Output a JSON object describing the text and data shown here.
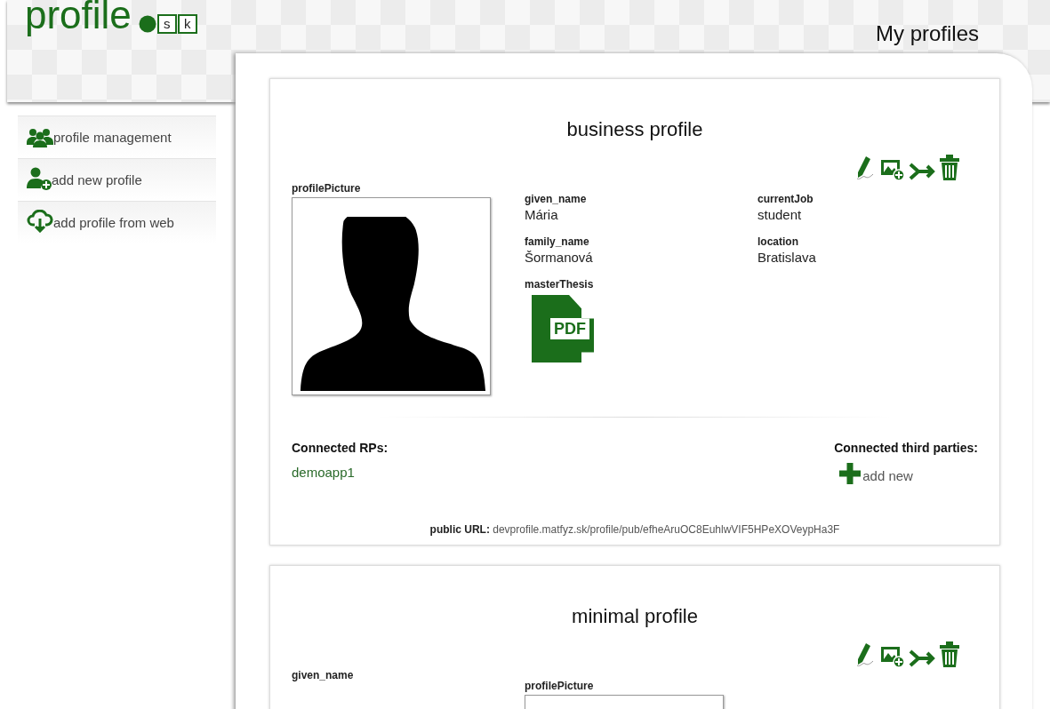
{
  "logo": {
    "word": "profile",
    "letters": [
      "s",
      "k"
    ]
  },
  "page_title": "My profiles",
  "sidebar": {
    "items": [
      {
        "kind": "group",
        "label": "profile management"
      },
      {
        "kind": "add-user",
        "label": "add new profile"
      },
      {
        "kind": "cloud",
        "label": "add profile from web"
      }
    ]
  },
  "profiles": [
    {
      "title": "business profile",
      "columns": [
        [
          {
            "kind": "picture",
            "label": "profilePicture"
          }
        ],
        [
          {
            "kind": "text",
            "label": "given_name",
            "value": "Mária"
          },
          {
            "kind": "text",
            "label": "family_name",
            "value": "Šormanová"
          },
          {
            "kind": "file",
            "label": "masterThesis",
            "value": "PDF"
          }
        ],
        [
          {
            "kind": "text",
            "label": "currentJob",
            "value": "student"
          },
          {
            "kind": "text",
            "label": "location",
            "value": "Bratislava"
          }
        ]
      ],
      "connected_rps": {
        "label": "Connected RPs:",
        "items": [
          "demoapp1"
        ]
      },
      "third_parties": {
        "label": "Connected third parties:",
        "add": "add new"
      },
      "public_url": {
        "label": "public URL:",
        "value": "devprofile.matfyz.sk/profile/pub/efheAruOC8EuhlwVIF5HPeXOVeypHa3F"
      }
    },
    {
      "title": "minimal profile",
      "columns": [
        [
          {
            "kind": "text",
            "label": "given_name"
          }
        ],
        [
          {
            "kind": "frame",
            "label": "profilePicture"
          }
        ]
      ]
    }
  ]
}
